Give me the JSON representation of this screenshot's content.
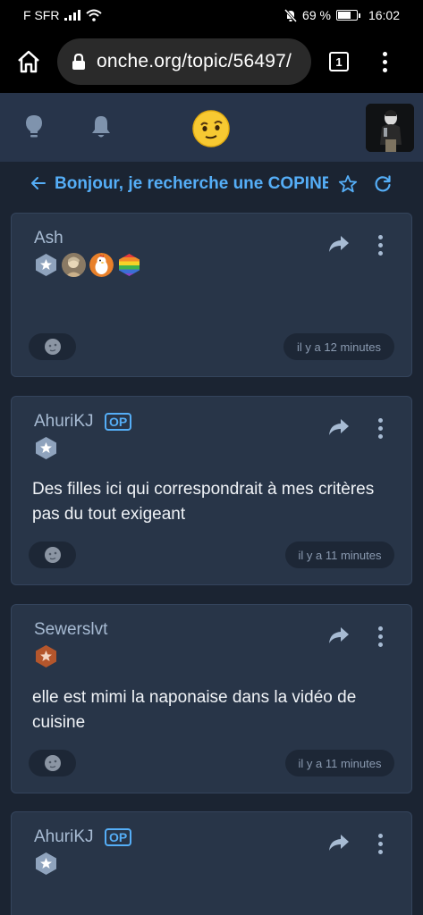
{
  "status_bar": {
    "carrier": "F SFR",
    "battery_pct": "69 %",
    "time": "16:02",
    "battery_level": 0.69
  },
  "browser": {
    "url": "onche.org/topic/56497/",
    "tab_count": "1",
    "icons": [
      "home-icon",
      "lock-icon",
      "tabs-icon",
      "menu-icon"
    ]
  },
  "header": {
    "icons": [
      "lightbulb-icon",
      "bell-icon",
      "onche-logo",
      "user-avatar"
    ]
  },
  "topic": {
    "title": "Bonjour, je recherche une COPINE",
    "icons": [
      "back-arrow-icon",
      "star-icon",
      "refresh-icon"
    ]
  },
  "posts": [
    {
      "author": "Ash",
      "is_op": false,
      "op_label": "",
      "badges": [
        "silver-star-badge",
        "avatar-badge",
        "chicken-badge",
        "rainbow-badge"
      ],
      "body": "",
      "time": "il y a 12 minutes"
    },
    {
      "author": "AhuriKJ",
      "is_op": true,
      "op_label": "OP",
      "badges": [
        "silver-star-badge"
      ],
      "body": "Des filles ici qui correspondrait à mes critères pas du tout exigeant",
      "time": "il y a 11 minutes"
    },
    {
      "author": "Sewerslvt",
      "is_op": false,
      "op_label": "",
      "badges": [
        "bronze-star-badge"
      ],
      "body": "elle est mimi la naponaise dans la vidéo de cuisine",
      "time": "il y a 11 minutes"
    },
    {
      "author": "AhuriKJ",
      "is_op": true,
      "op_label": "OP",
      "badges": [
        "silver-star-badge"
      ],
      "body": "",
      "time": ""
    }
  ],
  "colors": {
    "accent": "#55aef7",
    "background": "#1b2432",
    "card": "#283548",
    "header": "#27344a"
  }
}
